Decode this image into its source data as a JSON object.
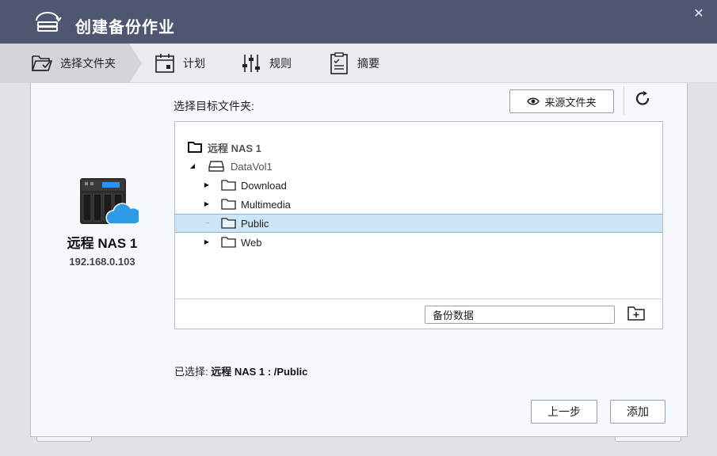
{
  "dialog": {
    "title": "创建备份作业",
    "close_glyph": "✕"
  },
  "steps": [
    {
      "label": "选择文件夹",
      "icon": "folder-select-icon",
      "active": true
    },
    {
      "label": "计划",
      "icon": "calendar-icon",
      "active": false
    },
    {
      "label": "规则",
      "icon": "sliders-icon",
      "active": false
    },
    {
      "label": "摘要",
      "icon": "checklist-icon",
      "active": false
    }
  ],
  "nas": {
    "name": "远程 NAS 1",
    "ip": "192.168.0.103"
  },
  "target": {
    "label": "选择目标文件夹:",
    "source_button": "来源文件夹"
  },
  "tree": {
    "root": "远程 NAS 1",
    "volume": "DataVol1",
    "folders": [
      "Download",
      "Multimedia",
      "Public",
      "Web"
    ],
    "selected_folder": "Public"
  },
  "new_folder": {
    "value": "备份数据"
  },
  "selection": {
    "prefix": "已选择:",
    "path": "远程 NAS 1 : /Public"
  },
  "buttons": {
    "back": "上一步",
    "add": "添加"
  },
  "colors": {
    "titlebar": "#4f5671",
    "selected_row": "#cde6f7",
    "cloud": "#2f9be6"
  }
}
